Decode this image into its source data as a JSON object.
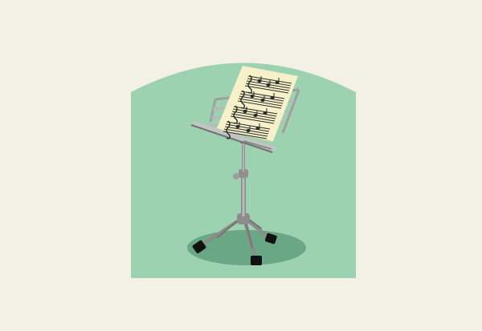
{
  "illustration": {
    "subject": "music-stand",
    "icons": {
      "stand": "music-stand-icon",
      "sheet": "sheet-music-icon"
    },
    "colors": {
      "background": "#f3f1e6",
      "arch": "#9dd2b0",
      "shadow": "#6aa785",
      "metal": "#a7a7a7",
      "metal_light": "#cfcfcf",
      "metal_dark": "#6d6d6d",
      "paper": "#f6f1c9",
      "paper_shadow": "#e0dbb5",
      "ink": "#2b2b2b",
      "foot": "#111111"
    }
  }
}
